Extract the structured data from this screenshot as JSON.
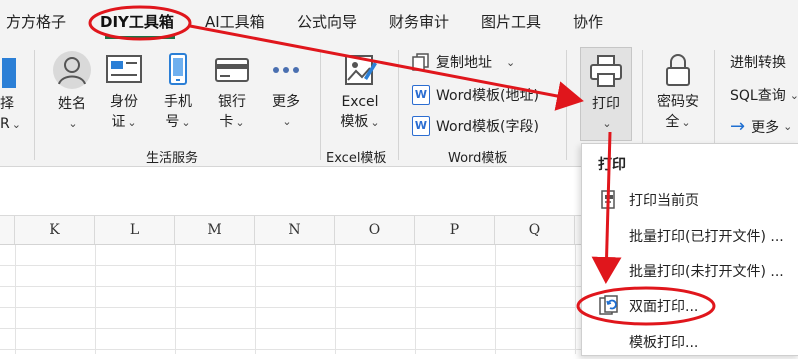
{
  "tabs": [
    {
      "label": "方方格子",
      "active": false
    },
    {
      "label": "DIY工具箱",
      "active": true
    },
    {
      "label": "AI工具箱",
      "active": false
    },
    {
      "label": "公式向导",
      "active": false
    },
    {
      "label": "财务审计",
      "active": false
    },
    {
      "label": "图片工具",
      "active": false
    },
    {
      "label": "协作",
      "active": false
    }
  ],
  "ribbon": {
    "left_partial": {
      "line1": "择",
      "line2": "R"
    },
    "life": {
      "name": "姓名",
      "id_card_1": "身份",
      "id_card_2": "证",
      "phone_1": "手机",
      "phone_2": "号",
      "bank_1": "银行",
      "bank_2": "卡",
      "more": "更多",
      "group_label": "生活服务"
    },
    "excel": {
      "line1": "Excel",
      "line2": "模板",
      "group_label": "Excel模板"
    },
    "word": {
      "copy_address": "复制地址",
      "word_address": "Word模板(地址)",
      "word_field": "Word模板(字段)",
      "group_label": "Word模板"
    },
    "print": {
      "label": "打印"
    },
    "password": {
      "line1": "密码安",
      "line2": "全"
    },
    "right": {
      "convert": "进制转换",
      "sql": "SQL查询",
      "more": "更多"
    }
  },
  "columns": [
    "K",
    "L",
    "M",
    "N",
    "O",
    "P",
    "Q"
  ],
  "dropdown": {
    "title": "打印",
    "items": [
      {
        "label": "打印当前页"
      },
      {
        "label": "批量打印(已打开文件) ..."
      },
      {
        "label": "批量打印(未打开文件) ..."
      },
      {
        "label": "双面打印..."
      },
      {
        "label": "模板打印..."
      }
    ]
  },
  "colors": {
    "accent_green": "#1e7145",
    "annotation_red": "#e0161c",
    "word_blue": "#2b6dd1",
    "arrow_blue": "#1f6fd1"
  },
  "icons": [
    "person-icon",
    "id-card-icon",
    "phone-icon",
    "bank-card-icon",
    "more-dots-icon",
    "excel-template-icon",
    "copy-icon",
    "word-icon",
    "printer-icon",
    "lock-icon",
    "arrow-right-icon",
    "print-page-icon",
    "duplex-print-icon"
  ]
}
